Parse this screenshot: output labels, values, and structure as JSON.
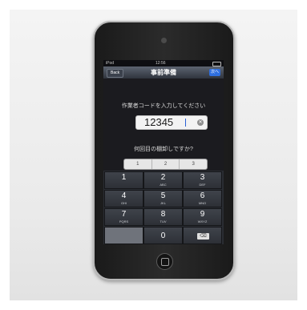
{
  "status_bar": {
    "carrier": "iPod",
    "time": "12:56",
    "battery": ""
  },
  "nav": {
    "back_label": "Back",
    "title": "事前準備",
    "action_label": "次へ"
  },
  "prompt_code": "作業者コードを入力してください",
  "input": {
    "value": "12345"
  },
  "prompt_round": "何回目の棚卸しですか?",
  "segments": [
    "1",
    "2",
    "3"
  ],
  "keypad": [
    {
      "num": "1",
      "letters": ""
    },
    {
      "num": "2",
      "letters": "ABC"
    },
    {
      "num": "3",
      "letters": "DEF"
    },
    {
      "num": "4",
      "letters": "GHI"
    },
    {
      "num": "5",
      "letters": "JKL"
    },
    {
      "num": "6",
      "letters": "MNO"
    },
    {
      "num": "7",
      "letters": "PQRS"
    },
    {
      "num": "8",
      "letters": "TUV"
    },
    {
      "num": "9",
      "letters": "WXYZ"
    },
    {
      "num": "0",
      "letters": ""
    }
  ]
}
